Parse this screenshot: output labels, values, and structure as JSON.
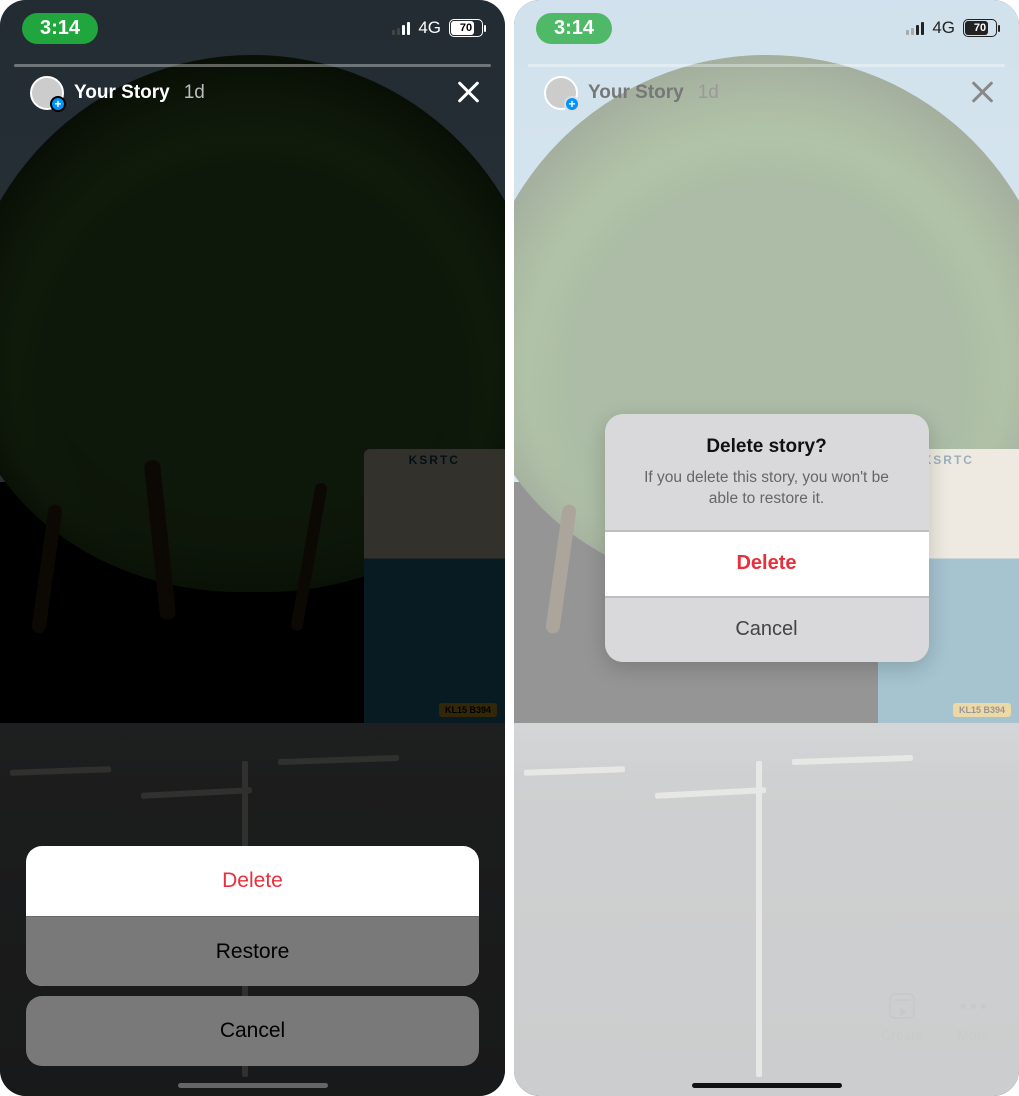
{
  "status": {
    "time": "3:14",
    "network": "4G",
    "battery": "70"
  },
  "story": {
    "label": "Your Story",
    "age": "1d"
  },
  "bus": {
    "name": "KSRTC",
    "plate": "KL15 B394"
  },
  "left_sheet": {
    "delete": "Delete",
    "restore": "Restore",
    "cancel": "Cancel"
  },
  "right_alert": {
    "title": "Delete story?",
    "message": "If you delete this story, you won't be able to restore it.",
    "delete": "Delete",
    "cancel": "Cancel"
  },
  "bottom": {
    "create": "Create",
    "more": "More"
  }
}
